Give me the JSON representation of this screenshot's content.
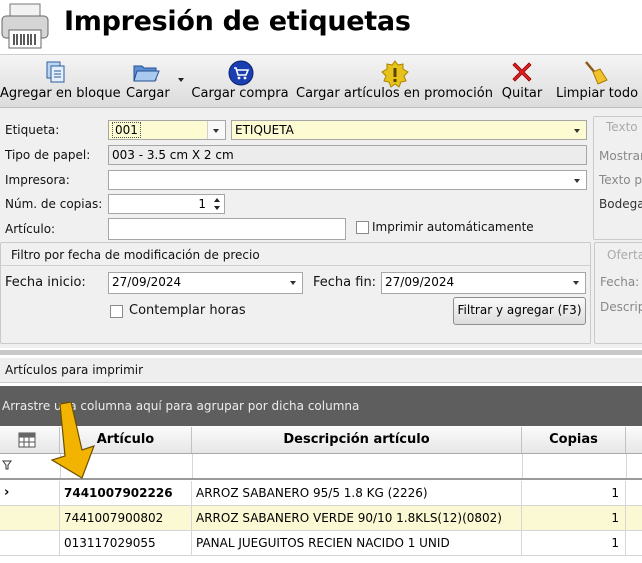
{
  "window": {
    "title": "Impresión de etiquetas",
    "printer_icon": "printer-icon"
  },
  "toolbar": {
    "items": [
      {
        "label": "Agregar en bloque",
        "icon": "documents-icon"
      },
      {
        "label": "Cargar",
        "icon": "folder-open-icon"
      },
      {
        "label": "Cargar compra",
        "icon": "cart-icon"
      },
      {
        "label": "Cargar artículos en promoción",
        "icon": "exclamation-badge-icon"
      },
      {
        "label": "Quitar",
        "icon": "red-x-icon"
      },
      {
        "label": "Limpiar todo",
        "icon": "broom-icon"
      }
    ]
  },
  "form": {
    "etiqueta_label": "Etiqueta:",
    "etiqueta_code": "001",
    "etiqueta_name": "ETIQUETA",
    "tipo_papel_label": "Tipo de papel:",
    "tipo_papel_value": "003 - 3.5 cm X 2 cm",
    "impresora_label": "Impresora:",
    "impresora_value": "",
    "copias_label": "Núm. de copias:",
    "copias_value": "1",
    "articulo_label": "Artículo:",
    "articulo_value": "",
    "auto_print_label": "Imprimir automáticamente",
    "right_panel": {
      "texto_group": "Texto",
      "mostrar": "Mostrar",
      "texto_p": "Texto p",
      "bodega": "Bodega",
      "oferta_group": "Oferta",
      "fecha": "Fecha:",
      "descrip": "Descrip"
    }
  },
  "filter": {
    "group_title": "Filtro por fecha de modificación de precio",
    "fecha_inicio_label": "Fecha inicio:",
    "fecha_inicio_value": "27/09/2024",
    "fecha_fin_label": "Fecha fin:",
    "fecha_fin_value": "27/09/2024",
    "contemplar_horas_label": "Contemplar horas",
    "filter_button": "Filtrar y agregar (F3)"
  },
  "grid": {
    "section_title": "Artículos para imprimir",
    "group_panel_text": "Arrastre una columna aquí para agrupar por dicha columna",
    "columns": [
      "Artículo",
      "Descripción artículo",
      "Copias"
    ],
    "rows": [
      {
        "articulo": "7441007902226",
        "descripcion": "ARROZ SABANERO 95/5 1.8 KG (2226)",
        "copias": "1",
        "current": true
      },
      {
        "articulo": "7441007900802",
        "descripcion": "ARROZ SABANERO VERDE 90/10 1.8KLS(12)(0802)",
        "copias": "1",
        "current": false
      },
      {
        "articulo": "013117029055",
        "descripcion": "PANAL JUEGUITOS RECIEN NACIDO 1 UNID",
        "copias": "1",
        "current": false
      }
    ]
  },
  "colors": {
    "accent_yellow": "#fdfbd2",
    "group_panel": "#5e5e5e",
    "annotation_arrow": "#f2b400"
  }
}
